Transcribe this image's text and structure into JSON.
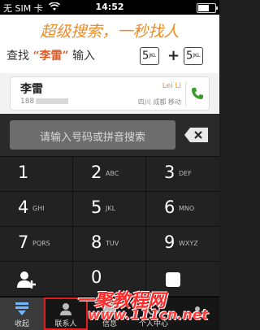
{
  "statusbar": {
    "carrier": "无 SIM 卡",
    "time": "14:52"
  },
  "banner": {
    "headline": "超级搜索，一秒找人",
    "instruction_prefix": "查找",
    "instruction_name": "“李雷”",
    "instruction_suffix": "输入",
    "key_digit": "5",
    "key_letters": "JKL",
    "plus": "+"
  },
  "contact": {
    "name": "李雷",
    "pinyin": "Lei Li",
    "phone_prefix": "188",
    "location": "四川 成都 移动"
  },
  "search": {
    "placeholder": "请输入号码或拼音搜索"
  },
  "keys": [
    {
      "num": "1",
      "letters": ""
    },
    {
      "num": "2",
      "letters": "ABC"
    },
    {
      "num": "3",
      "letters": "DEF"
    },
    {
      "num": "4",
      "letters": "GHI"
    },
    {
      "num": "5",
      "letters": "JKL"
    },
    {
      "num": "6",
      "letters": "MNO"
    },
    {
      "num": "7",
      "letters": "PQRS"
    },
    {
      "num": "8",
      "letters": "TUV"
    },
    {
      "num": "9",
      "letters": "WXYZ"
    },
    {
      "num": "",
      "letters": "",
      "icon": "add-contact-icon"
    },
    {
      "num": "0",
      "letters": ""
    },
    {
      "num": "",
      "letters": "",
      "icon": "more-icon"
    }
  ],
  "bottombar": {
    "items": [
      {
        "label": "收起",
        "icon": "collapse-icon"
      },
      {
        "label": "联系人",
        "icon": "contacts-icon"
      },
      {
        "label": "信息",
        "icon": "message-icon"
      },
      {
        "label": "个人中心",
        "icon": "profile-icon"
      },
      {
        "label": "",
        "icon": "settings-icon"
      }
    ]
  },
  "watermark": {
    "text": "一聚教程网",
    "url": "www.111cn.net"
  }
}
